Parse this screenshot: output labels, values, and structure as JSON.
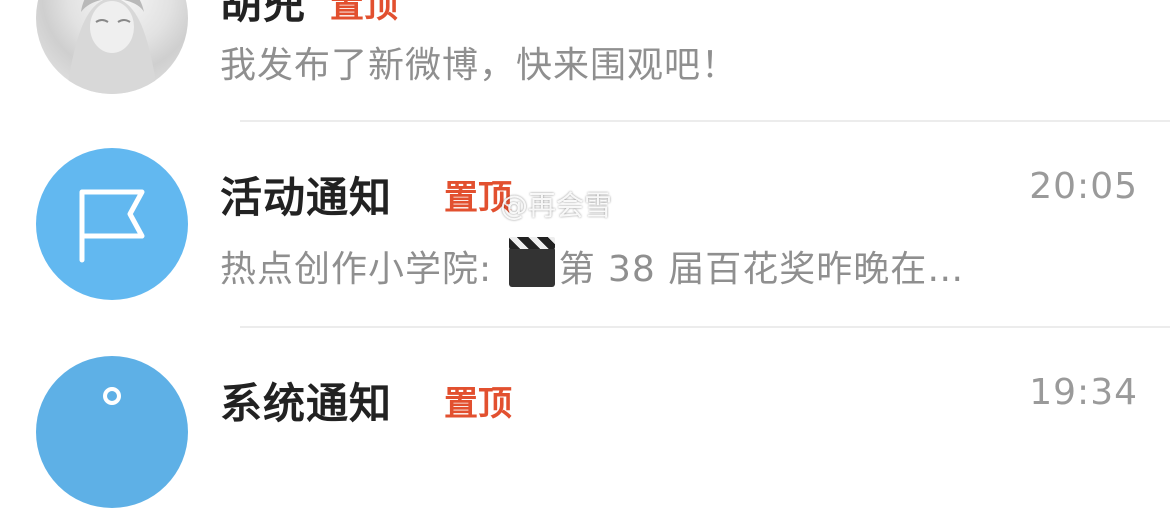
{
  "messages": [
    {
      "title": "胡兜",
      "pin_label": "置顶",
      "preview": "我发布了新微博，快来围观吧！",
      "time": "",
      "avatar": "user-photo-avatar"
    },
    {
      "title": "活动通知",
      "pin_label": "置顶",
      "preview_prefix": "热点创作小学院: ",
      "preview_icon": "clapperboard-emoji",
      "preview_suffix": "第 38 届百花奖昨晚在…",
      "time": "20:05",
      "avatar": "flag-icon"
    },
    {
      "title": "系统通知",
      "pin_label": "置顶",
      "time": "19:34",
      "avatar": "system-icon"
    }
  ],
  "watermark": "@再会雪",
  "colors": {
    "pin": "#e2502f",
    "avatar_blue": "#62b8f0",
    "title": "#222222",
    "preview": "#8f8f8f"
  }
}
